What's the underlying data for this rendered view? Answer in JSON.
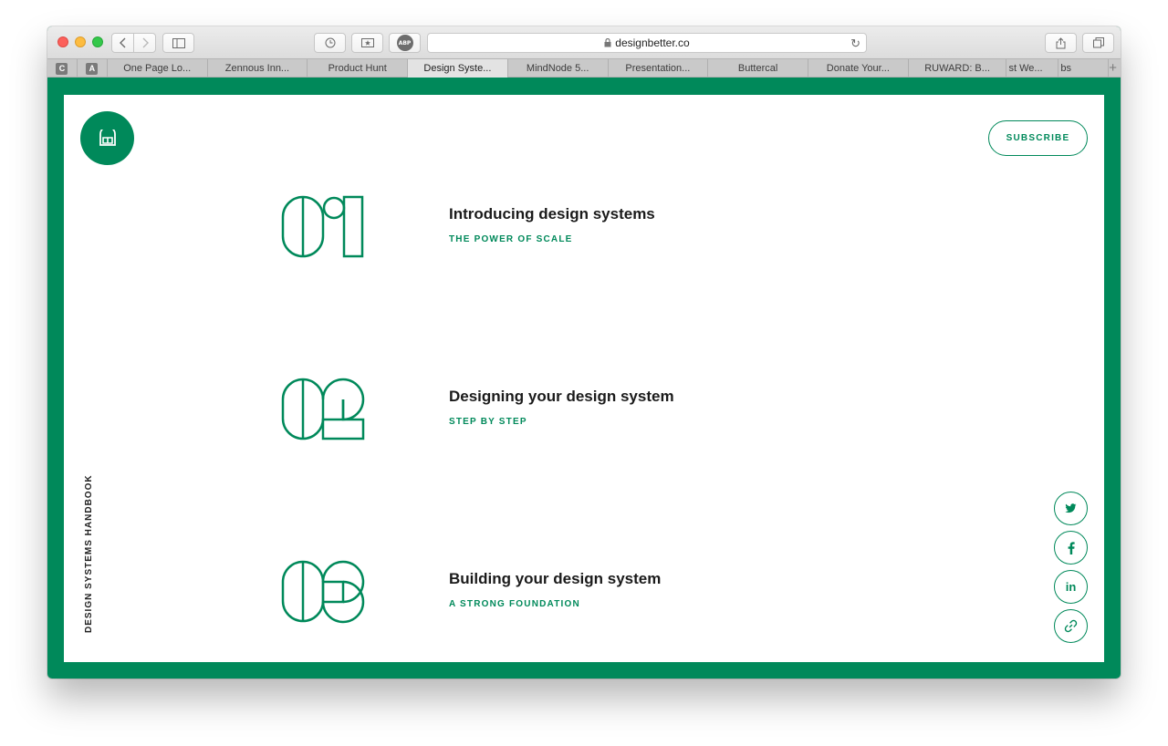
{
  "browser": {
    "url": "designbetter.co",
    "pinned_tabs": [
      "C",
      "A"
    ],
    "tabs": [
      {
        "label": "One Page Lo..."
      },
      {
        "label": "Zennous Inn..."
      },
      {
        "label": "Product Hunt"
      },
      {
        "label": "Design Syste..."
      },
      {
        "label": "MindNode 5..."
      },
      {
        "label": "Presentation..."
      },
      {
        "label": "Buttercal"
      },
      {
        "label": "Donate Your..."
      },
      {
        "label": "RUWARD: B..."
      },
      {
        "label": "st We..."
      },
      {
        "label": "bs"
      }
    ],
    "active_tab": 3,
    "new_tab_symbol": "+",
    "abp_label": "ABP"
  },
  "page": {
    "side_title": "DESIGN SYSTEMS HANDBOOK",
    "subscribe_label": "SUBSCRIBE",
    "chapters": [
      {
        "number": "01",
        "title": "Introducing design systems",
        "subtitle": "THE POWER OF SCALE"
      },
      {
        "number": "02",
        "title": "Designing your design system",
        "subtitle": "STEP BY STEP"
      },
      {
        "number": "03",
        "title": "Building your design system",
        "subtitle": "A STRONG FOUNDATION"
      }
    ],
    "social": [
      {
        "icon": "twitter-icon",
        "glyph": "t"
      },
      {
        "icon": "facebook-icon",
        "glyph": "f"
      },
      {
        "icon": "linkedin-icon",
        "glyph": "in"
      },
      {
        "icon": "link-icon",
        "glyph": "🔗"
      }
    ]
  },
  "colors": {
    "brand_green": "#00895a"
  }
}
